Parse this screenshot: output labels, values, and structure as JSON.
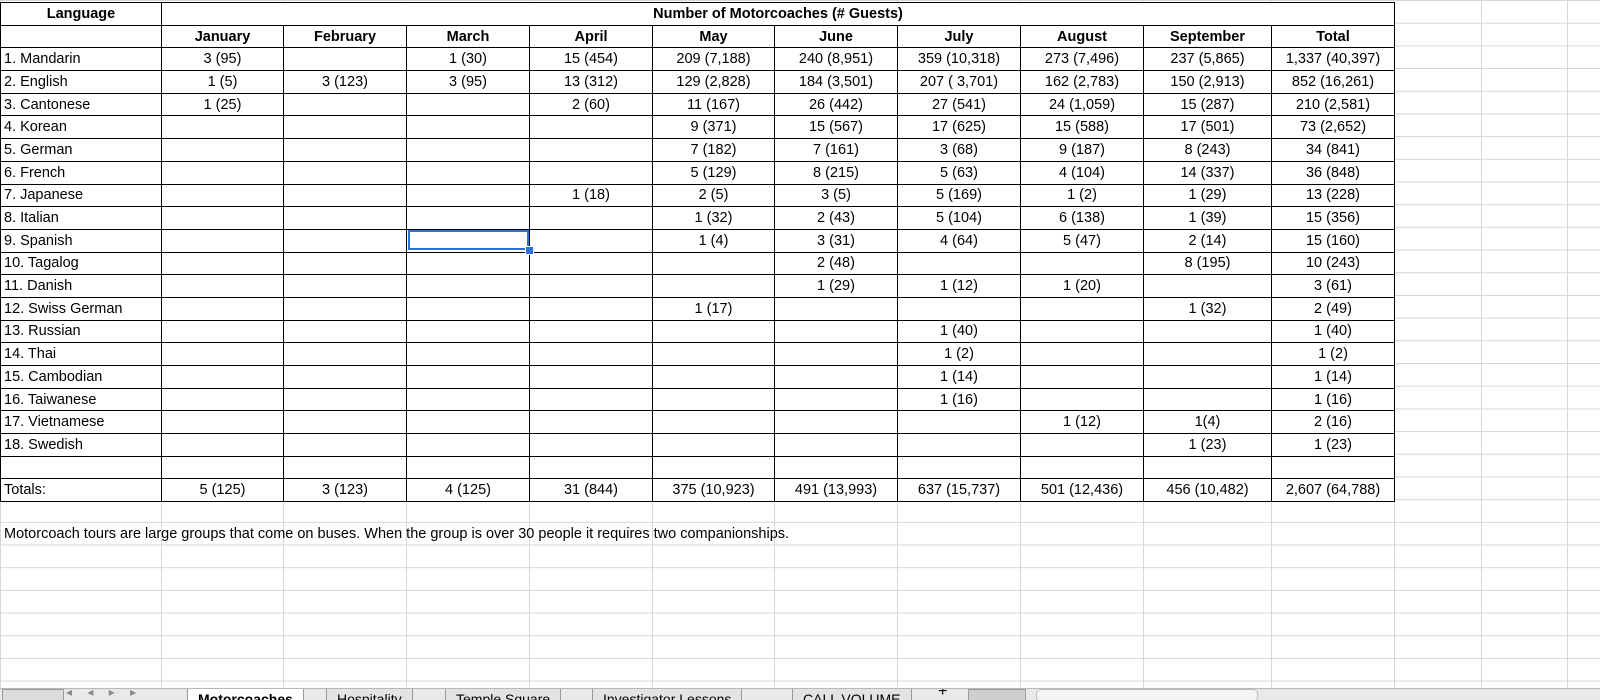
{
  "sheet": {
    "header_language": "Language",
    "header_group": "Number of Motorcoaches (# Guests)",
    "months": [
      "January",
      "February",
      "March",
      "April",
      "May",
      "June",
      "July",
      "August",
      "September",
      "Total"
    ],
    "rows": [
      {
        "lang": "1. Mandarin",
        "vals": [
          "3 (95)",
          "",
          "1 (30)",
          "15 (454)",
          "209 (7,188)",
          "240 (8,951)",
          "359 (10,318)",
          "273 (7,496)",
          "237 (5,865)",
          "1,337 (40,397)"
        ]
      },
      {
        "lang": "2. English",
        "vals": [
          "1 (5)",
          "3 (123)",
          "3 (95)",
          "13 (312)",
          "129 (2,828)",
          "184 (3,501)",
          "207 ( 3,701)",
          "162 (2,783)",
          "150 (2,913)",
          "852 (16,261)"
        ]
      },
      {
        "lang": "3. Cantonese",
        "vals": [
          "1 (25)",
          "",
          "",
          "2 (60)",
          "11 (167)",
          "26 (442)",
          "27 (541)",
          "24 (1,059)",
          "15 (287)",
          "210 (2,581)"
        ]
      },
      {
        "lang": "4. Korean",
        "vals": [
          "",
          "",
          "",
          "",
          "9 (371)",
          "15 (567)",
          "17 (625)",
          "15 (588)",
          "17 (501)",
          "73 (2,652)"
        ]
      },
      {
        "lang": "5. German",
        "vals": [
          "",
          "",
          "",
          "",
          "7 (182)",
          "7 (161)",
          "3 (68)",
          "9 (187)",
          "8 (243)",
          "34 (841)"
        ]
      },
      {
        "lang": "6. French",
        "vals": [
          "",
          "",
          "",
          "",
          "5 (129)",
          "8 (215)",
          "5 (63)",
          "4 (104)",
          "14 (337)",
          "36 (848)"
        ]
      },
      {
        "lang": "7. Japanese",
        "vals": [
          "",
          "",
          "",
          "1 (18)",
          "2 (5)",
          "3 (5)",
          "5 (169)",
          "1 (2)",
          "1 (29)",
          "13 (228)"
        ]
      },
      {
        "lang": "8. Italian",
        "vals": [
          "",
          "",
          "",
          "",
          "1 (32)",
          "2 (43)",
          "5 (104)",
          "6 (138)",
          "1 (39)",
          "15 (356)"
        ]
      },
      {
        "lang": "9. Spanish",
        "vals": [
          "",
          "",
          "",
          "",
          "1 (4)",
          "3 (31)",
          "4 (64)",
          "5 (47)",
          "2 (14)",
          "15 (160)"
        ]
      },
      {
        "lang": "10. Tagalog",
        "vals": [
          "",
          "",
          "",
          "",
          "",
          "2 (48)",
          "",
          "",
          "8 (195)",
          "10 (243)"
        ]
      },
      {
        "lang": "11. Danish",
        "vals": [
          "",
          "",
          "",
          "",
          "",
          "1 (29)",
          "1 (12)",
          "1 (20)",
          "",
          "3 (61)"
        ]
      },
      {
        "lang": "12. Swiss German",
        "vals": [
          "",
          "",
          "",
          "",
          "1 (17)",
          "",
          "",
          "",
          "1 (32)",
          "2 (49)"
        ]
      },
      {
        "lang": "13. Russian",
        "vals": [
          "",
          "",
          "",
          "",
          "",
          "",
          "1 (40)",
          "",
          "",
          "1 (40)"
        ]
      },
      {
        "lang": "14. Thai",
        "vals": [
          "",
          "",
          "",
          "",
          "",
          "",
          "1 (2)",
          "",
          "",
          "1 (2)"
        ]
      },
      {
        "lang": "15. Cambodian",
        "vals": [
          "",
          "",
          "",
          "",
          "",
          "",
          "1 (14)",
          "",
          "",
          "1 (14)"
        ]
      },
      {
        "lang": "16. Taiwanese",
        "vals": [
          "",
          "",
          "",
          "",
          "",
          "",
          "1 (16)",
          "",
          "",
          "1 (16)"
        ]
      },
      {
        "lang": "17. Vietnamese",
        "vals": [
          "",
          "",
          "",
          "",
          "",
          "",
          "",
          "1 (12)",
          "1(4)",
          "2 (16)"
        ]
      },
      {
        "lang": "18. Swedish",
        "vals": [
          "",
          "",
          "",
          "",
          "",
          "",
          "",
          "",
          "1 (23)",
          "1 (23)"
        ]
      }
    ],
    "totals": {
      "label": "Totals:",
      "vals": [
        "5 (125)",
        "3 (123)",
        "4 (125)",
        "31 (844)",
        "375 (10,923)",
        "491 (13,993)",
        "637 (15,737)",
        "501 (12,436)",
        "456 (10,482)",
        "2,607 (64,788)"
      ]
    },
    "note": "Motorcoach tours are large groups that come on buses. When the group is over 30 people it requires two companionships."
  },
  "tabs": {
    "items": [
      "Motorcoaches",
      "Hospitality",
      "Temple Square",
      "Investigator Lessons",
      "CALL VOLUME"
    ],
    "active": "Motorcoaches",
    "add_label": "+"
  },
  "colors": {
    "selection": "#2f6fd6",
    "gridline": "#d6d6d6"
  }
}
